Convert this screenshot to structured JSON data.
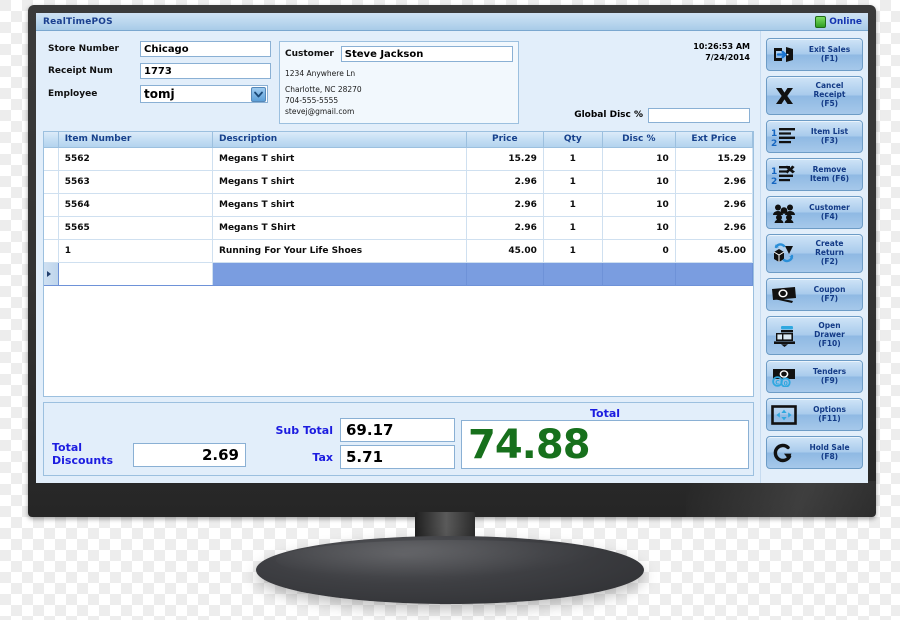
{
  "app": {
    "title": "RealTimePOS",
    "status": {
      "label": "Online",
      "icon": "online-indicator-icon"
    }
  },
  "form": {
    "store_number": {
      "label": "Store Number",
      "value": "Chicago"
    },
    "receipt_num": {
      "label": "Receipt Num",
      "value": "1773"
    },
    "employee": {
      "label": "Employee",
      "value": "tomj",
      "icon": "chevron-down-icon"
    },
    "customer": {
      "label": "Customer",
      "value": "Steve Jackson",
      "address_line1": "1234 Anywhere Ln",
      "address_line2": "Charlotte, NC 28270",
      "phone": "704-555-5555",
      "email": "stevej@gmail.com"
    },
    "clock": {
      "time": "10:26:53 AM",
      "date": "7/24/2014"
    },
    "global_disc": {
      "label": "Global Disc %",
      "value": ""
    }
  },
  "grid": {
    "columns": [
      "Item Number",
      "Description",
      "Price",
      "Qty",
      "Disc %",
      "Ext Price"
    ],
    "rows": [
      {
        "item": "5562",
        "desc": "Megans T shirt",
        "price": "15.29",
        "qty": "1",
        "disc": "10",
        "ext": "15.29"
      },
      {
        "item": "5563",
        "desc": "Megans T shirt",
        "price": "2.96",
        "qty": "1",
        "disc": "10",
        "ext": "2.96"
      },
      {
        "item": "5564",
        "desc": "Megans T shirt",
        "price": "2.96",
        "qty": "1",
        "disc": "10",
        "ext": "2.96"
      },
      {
        "item": "5565",
        "desc": "Megans T Shirt",
        "price": "2.96",
        "qty": "1",
        "disc": "10",
        "ext": "2.96"
      },
      {
        "item": "1",
        "desc": "Running For Your Life Shoes",
        "price": "45.00",
        "qty": "1",
        "disc": "0",
        "ext": "45.00"
      }
    ],
    "new_row": {
      "item": "",
      "desc": "",
      "price": "",
      "qty": "",
      "disc": "",
      "ext": ""
    }
  },
  "totals": {
    "total_discounts_label": "Total Discounts",
    "total_discounts_value": "2.69",
    "sub_total_label": "Sub Total",
    "sub_total_value": "69.17",
    "tax_label": "Tax",
    "tax_value": "5.71",
    "total_label": "Total",
    "total_value": "74.88",
    "total_color": "#17701c",
    "label_color": "#1c1ce0"
  },
  "sidebar": {
    "buttons": [
      {
        "label": "Exit Sales (F1)",
        "line1": "Exit Sales",
        "line2": "(F1)",
        "icon": "exit-door-icon"
      },
      {
        "label": "Cancel Receipt (F5)",
        "line1": "Cancel",
        "line2": "Receipt",
        "line3": "(F5)",
        "icon": "x-cross-icon"
      },
      {
        "label": "Item List (F3)",
        "line1": "Item List",
        "line2": "(F3)",
        "icon": "numbered-list-icon"
      },
      {
        "label": "Remove Item (F6)",
        "line1": "Remove",
        "line2": "Item (F6)",
        "icon": "remove-list-item-icon"
      },
      {
        "label": "Customer (F4)",
        "line1": "Customer",
        "line2": "(F4)",
        "icon": "people-group-icon"
      },
      {
        "label": "Create Return (F2)",
        "line1": "Create",
        "line2": "Return",
        "line3": "(F2)",
        "icon": "return-box-icon"
      },
      {
        "label": "Coupon (F7)",
        "line1": "Coupon",
        "line2": "(F7)",
        "icon": "coupon-icon"
      },
      {
        "label": "Open Drawer (F10)",
        "line1": "Open",
        "line2": "Drawer",
        "line3": "(F10)",
        "icon": "cash-register-icon"
      },
      {
        "label": "Tenders (F9)",
        "line1": "Tenders",
        "line2": "(F9)",
        "icon": "money-coins-icon"
      },
      {
        "label": "Options (F11)",
        "line1": "Options",
        "line2": "(F11)",
        "icon": "arrows-options-icon"
      },
      {
        "label": "Hold Sale (F8)",
        "line1": "Hold Sale",
        "line2": "(F8)",
        "icon": "hold-arrow-icon"
      }
    ]
  }
}
